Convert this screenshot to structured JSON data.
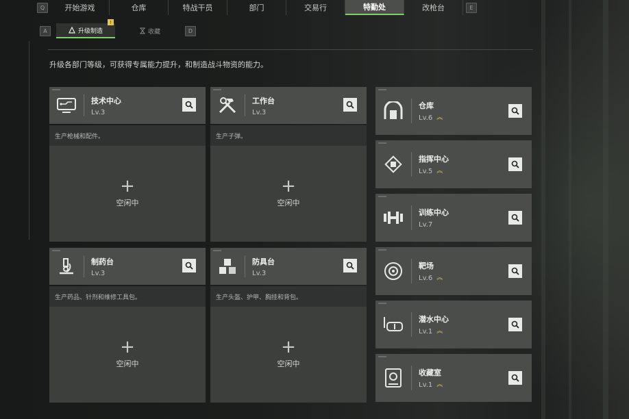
{
  "nav": {
    "key_left": "Q",
    "key_right": "E",
    "tabs": [
      "开始游戏",
      "仓库",
      "特战干员",
      "部门",
      "交易行",
      "特勤处",
      "改枪台"
    ],
    "active_tab": 5
  },
  "subnav": {
    "key_left": "A",
    "key_right": "D",
    "tabs": [
      "升级制造",
      "收藏"
    ],
    "badge": "!"
  },
  "description": "升级各部门等级，可获得专属能力提升，和制造战斗物资的能力。",
  "production": [
    {
      "name": "技术中心",
      "level": "Lv.3",
      "desc": "生产枪械和配件。",
      "status": "空闲中",
      "icon": "circuit-monitor-icon"
    },
    {
      "name": "工作台",
      "level": "Lv.3",
      "desc": "生产子弹。",
      "status": "空闲中",
      "icon": "tools-icon"
    },
    {
      "name": "制药台",
      "level": "Lv.3",
      "desc": "生产药品、针剂和维修工具包。",
      "status": "空闲中",
      "icon": "microscope-icon"
    },
    {
      "name": "防具台",
      "level": "Lv.3",
      "desc": "生产头盔、护甲、胸挂和背包。",
      "status": "空闲中",
      "icon": "cubes-icon"
    }
  ],
  "departments": [
    {
      "name": "仓库",
      "level": "Lv.6",
      "upgradable": true,
      "icon": "warehouse-icon"
    },
    {
      "name": "指挥中心",
      "level": "Lv.5",
      "upgradable": true,
      "icon": "chip-icon"
    },
    {
      "name": "训练中心",
      "level": "Lv.7",
      "upgradable": false,
      "icon": "dumbbell-icon"
    },
    {
      "name": "靶场",
      "level": "Lv.6",
      "upgradable": true,
      "icon": "target-icon"
    },
    {
      "name": "潜水中心",
      "level": "Lv.1",
      "upgradable": true,
      "icon": "diving-mask-icon"
    },
    {
      "name": "收藏室",
      "level": "Lv.1",
      "upgradable": true,
      "icon": "vault-icon"
    }
  ],
  "colors": {
    "accent": "#7fd16a",
    "upgrade": "#e7c34a",
    "card": "#4a4d4a",
    "slot": "#3c3f3c"
  }
}
